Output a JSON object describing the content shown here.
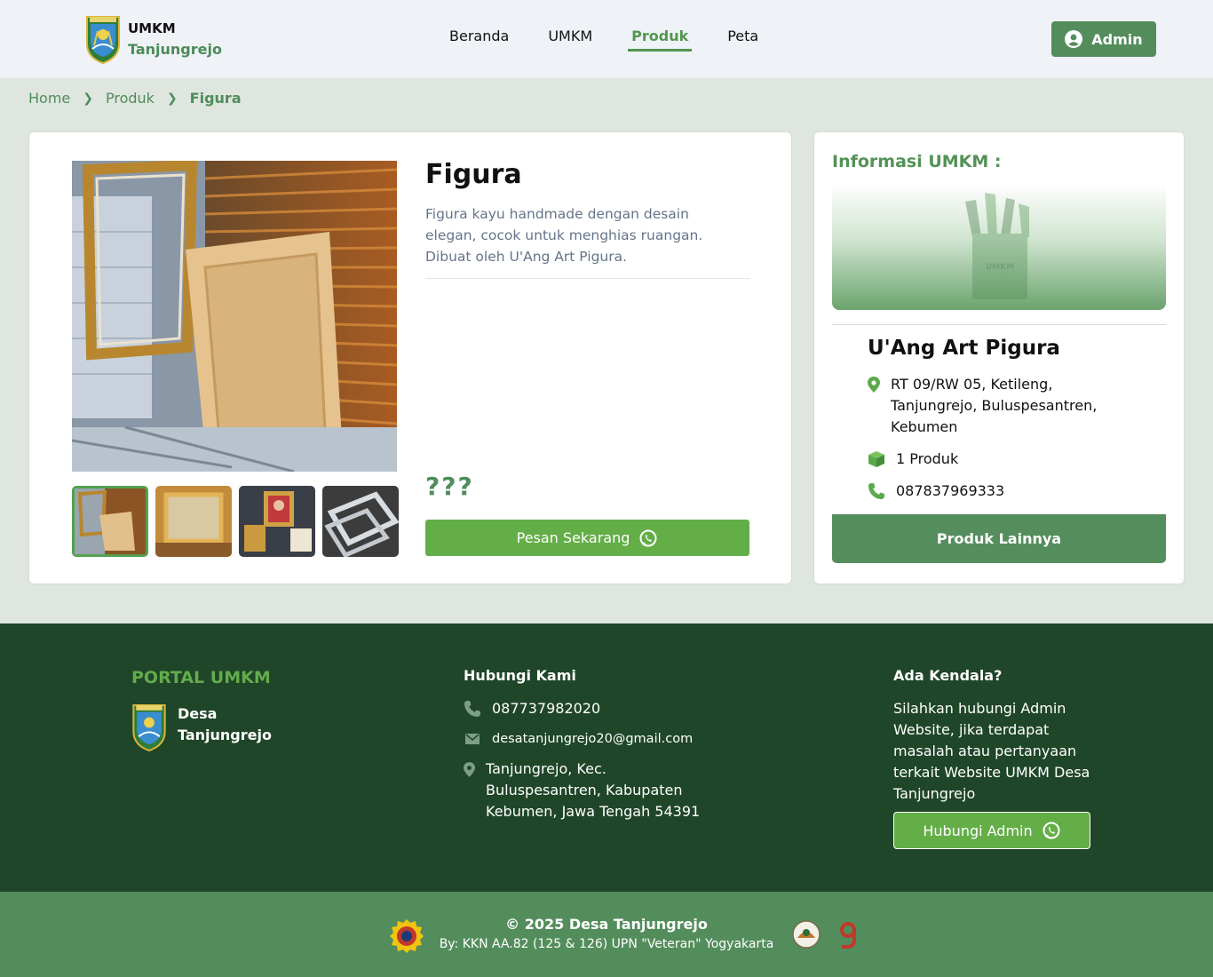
{
  "header": {
    "brand_line1": "UMKM",
    "brand_line2": "Tanjungrejo",
    "nav": [
      "Beranda",
      "UMKM",
      "Produk",
      "Peta"
    ],
    "active_nav": "Produk",
    "admin_label": "Admin"
  },
  "breadcrumb": {
    "home": "Home",
    "section": "Produk",
    "current": "Figura"
  },
  "product": {
    "title": "Figura",
    "description": "Figura kayu handmade dengan desain elegan, cocok untuk menghias ruangan. Dibuat oleh U'Ang Art Pigura.",
    "price": "???",
    "order_label": "Pesan Sekarang",
    "thumbnail_count": 4
  },
  "umkm_info": {
    "heading": "Informasi UMKM :",
    "banner_text": "UMKM",
    "name": "U'Ang Art Pigura",
    "address": "RT 09/RW 05, Ketileng, Tanjungrejo, Buluspesantren, Kebumen",
    "product_count": "1 Produk",
    "phone": "087837969333",
    "more_label": "Produk Lainnya"
  },
  "footer": {
    "portal_title": "PORTAL UMKM",
    "brand_line1": "Desa",
    "brand_line2": "Tanjungrejo",
    "contact_heading": "Hubungi Kami",
    "phone": "087737982020",
    "email": "desatanjungrejo20@gmail.com",
    "address": "Tanjungrejo, Kec. Buluspesantren, Kabupaten Kebumen, Jawa Tengah 54391",
    "issue_heading": "Ada Kendala?",
    "issue_text": "Silahkan hubungi Admin Website, jika terdapat masalah atau pertanyaan terkait Website UMKM Desa Tanjungrejo",
    "issue_button": "Hubungi Admin",
    "copyright": "© 2025 Desa Tanjungrejo",
    "credit": "By: KKN AA.82 (125 & 126) UPN \"Veteran\" Yogyakarta"
  },
  "colors": {
    "primary_green": "#538d5c",
    "accent_green": "#64ae48",
    "footer_dark": "#1f4628",
    "page_bg": "#dfe6df"
  }
}
